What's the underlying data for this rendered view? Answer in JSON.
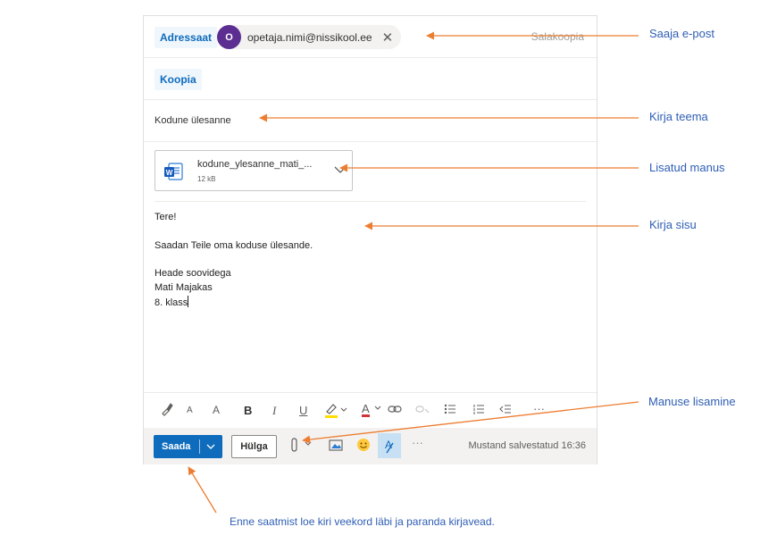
{
  "compose": {
    "to_label": "Adressaat",
    "recipient": {
      "initial": "O",
      "email": "opetaja.nimi@nissikool.ee",
      "avatar_color": "#5c2e91"
    },
    "bcc_label": "Salakoopia",
    "cc_label": "Koopia",
    "subject": "Kodune ülesanne",
    "attachment": {
      "name": "kodune_ylesanne_mati_...",
      "size": "12 kB",
      "icon": "word-document-icon"
    },
    "body_lines": [
      "Tere!",
      "",
      "Saadan Teile oma koduse ülesande.",
      "",
      "Heade soovidega",
      "Mati Majakas",
      "8. klass"
    ],
    "formatting_toolbar": {
      "font_size_small": "A",
      "font_size_large": "A",
      "bold": "B",
      "italic": "I",
      "underline": "U",
      "font_color": "A",
      "more": "···",
      "icons": [
        "format-painter-icon",
        "font-size-decrease-icon",
        "font-size-increase-icon",
        "bold-icon",
        "italic-icon",
        "underline-icon",
        "highlight-icon",
        "font-color-icon",
        "link-icon",
        "unlink-icon",
        "bullets-icon",
        "numbering-icon",
        "decrease-indent-icon",
        "more-icon"
      ]
    },
    "actions": {
      "send_label": "Saada",
      "discard_label": "Hülga",
      "more": "···",
      "saved_status": "Mustand salvestatud 16:36",
      "icons": [
        "attach-icon",
        "insert-picture-icon",
        "emoji-icon",
        "editor-icon",
        "more-icon"
      ]
    }
  },
  "colors": {
    "accent": "#0f6cbd",
    "annotation": "#2f5eb5",
    "arrow": "#ed7d31"
  },
  "annotations": {
    "recipient": "Saaja e-post",
    "subject": "Kirja teema",
    "attachment": "Lisatud manus",
    "body": "Kirja sisu",
    "attach_button": "Manuse lisamine",
    "send_tip": "Enne saatmist loe kiri veekord läbi ja paranda kirjavead."
  }
}
